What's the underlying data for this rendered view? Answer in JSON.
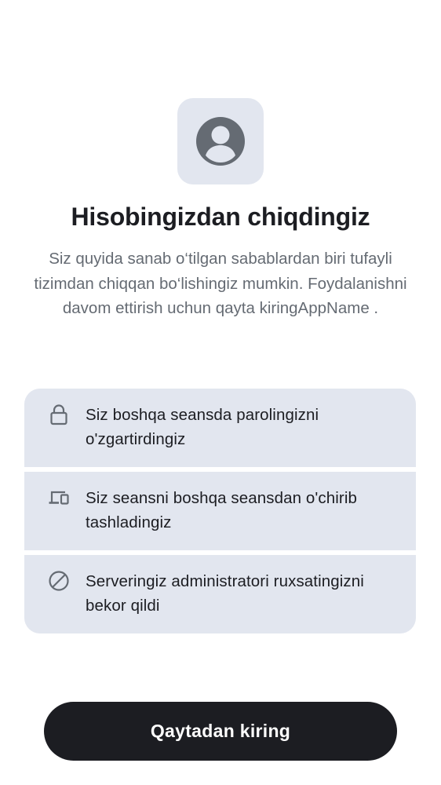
{
  "header": {
    "icon": "user-avatar-icon",
    "title": "Hisobingizdan chiqdingiz",
    "subtitle": "Siz quyida sanab o‘tilgan sabablardan biri tufayli tizimdan chiqqan bo‘lishingiz mumkin. Foydalanishni davom ettirish uchun qayta kiringAppName ."
  },
  "reasons": [
    {
      "icon": "lock-icon",
      "text": "Siz boshqa seansda parolingizni o'zgartirdingiz"
    },
    {
      "icon": "devices-icon",
      "text": "Siz seansni boshqa seansdan o'chirib tashladingiz"
    },
    {
      "icon": "block-icon",
      "text": "Serveringiz administratori ruxsatingizni bekor qildi"
    }
  ],
  "actions": {
    "sign_in_again_label": "Qaytadan kiring"
  },
  "colors": {
    "primary": "#1c1d22",
    "card_background": "#e2e6ef",
    "secondary_text": "#656b73",
    "icon": "#656b73"
  }
}
